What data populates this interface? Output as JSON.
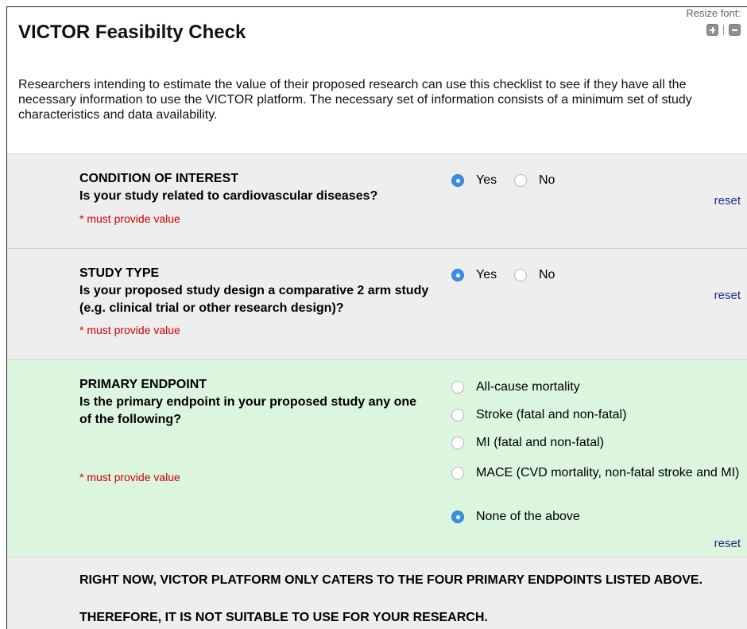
{
  "header": {
    "title": "VICTOR Feasibilty Check",
    "resize_label": "Resize font:"
  },
  "intro": "Researchers intending to estimate the value of their proposed research can use this checklist to see if they have all the necessary information to use the VICTOR platform. The necessary set of information consists of a minimum set of study characteristics and data availability.",
  "questions": [
    {
      "title": "CONDITION OF INTEREST",
      "text": "Is your study related to cardiovascular diseases?",
      "required": "* must provide value",
      "options": [
        "Yes",
        "No"
      ],
      "selected": "Yes",
      "reset": "reset"
    },
    {
      "title": "STUDY TYPE",
      "text": "Is your proposed study design a comparative 2 arm study (e.g. clinical trial or other research design)?",
      "required": "* must provide value",
      "options": [
        "Yes",
        "No"
      ],
      "selected": "Yes",
      "reset": "reset"
    },
    {
      "title": "PRIMARY ENDPOINT",
      "text": "Is the primary endpoint in your proposed study any one of the following?",
      "required": "* must provide value",
      "options": [
        "All-cause mortality",
        "Stroke (fatal and non-fatal)",
        "MI (fatal and non-fatal)",
        "MACE (CVD mortality, non-fatal stroke and MI)",
        "None of the above"
      ],
      "selected": "None of the above",
      "reset": "reset"
    }
  ],
  "notice": {
    "line1": "RIGHT NOW, VICTOR PLATFORM ONLY CATERS TO THE FOUR PRIMARY ENDPOINTS LISTED ABOVE.",
    "line2": "THEREFORE, IT IS NOT SUITABLE TO USE FOR YOUR RESEARCH."
  },
  "colors": {
    "radio_selected": "#3b8fe8",
    "required_text": "#cc0000",
    "link": "#1c2f80",
    "gray_row": "#eeeeee",
    "green_row": "#dcf5de"
  }
}
